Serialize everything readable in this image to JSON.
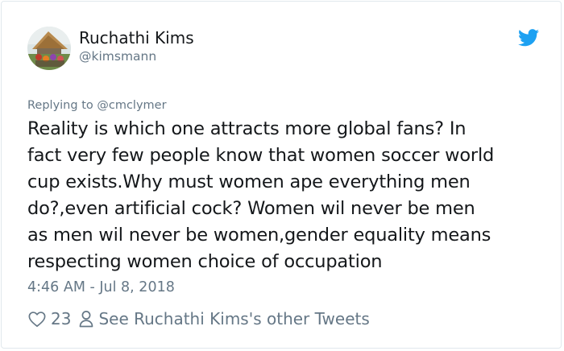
{
  "tweet": {
    "author": {
      "display_name": "Ruchathi Kims",
      "handle": "@kimsmann"
    },
    "reply_context": "Replying to @cmclymer",
    "text_lines": [
      "Reality is which one attracts more global fans? In",
      "fact very few people know that women soccer world",
      "cup exists.Why must women ape everything men",
      "do?,even artificial cock? Women wil never be men",
      "as men wil never be women,gender equality means",
      "respecting women choice of occupation"
    ],
    "timestamp": "4:46 AM - Jul 8, 2018",
    "likes": "23",
    "other_tweets_label": "See Ruchathi Kims's other Tweets"
  },
  "icons": {
    "brand": "twitter-bird-icon",
    "like": "heart-icon",
    "profile": "person-icon"
  },
  "colors": {
    "twitter_blue": "#1da1f2",
    "text_primary": "#14171a",
    "text_secondary": "#657786",
    "border": "#e1e8ed"
  }
}
